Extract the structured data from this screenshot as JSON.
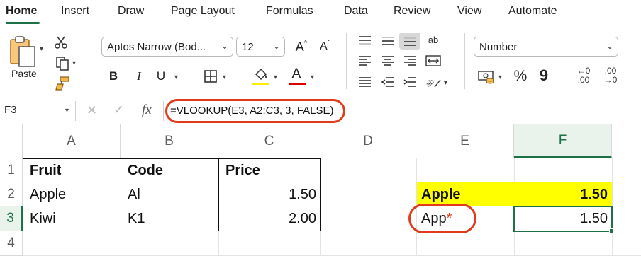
{
  "tabs": [
    "Home",
    "Insert",
    "Draw",
    "Page Layout",
    "Formulas",
    "Data",
    "Review",
    "View",
    "Automate"
  ],
  "ribbon": {
    "paste_label": "Paste",
    "font_name": "Aptos Narrow (Bod...",
    "font_size": "12",
    "bold_label": "B",
    "italic_label": "I",
    "underline_label": "U",
    "font_color_letter": "A",
    "grow_font_letter": "A",
    "shrink_font_letter": "A",
    "number_format": "Number",
    "percent_label": "%",
    "comma_label": "9",
    "increase_decimal_top": "←0",
    "increase_decimal_bottom": ".00",
    "decrease_decimal_top": ".00",
    "decrease_decimal_bottom": "→0",
    "wrap_label": "ab",
    "accent_yellow": "#FFEC00",
    "accent_red": "#E00000"
  },
  "formula_bar": {
    "name_box": "F3",
    "fx_label": "fx",
    "formula": "=VLOOKUP(E3, A2:C3, 3, FALSE)"
  },
  "grid": {
    "columns": [
      "A",
      "B",
      "C",
      "D",
      "E",
      "F"
    ],
    "rows": [
      "1",
      "2",
      "3",
      "4"
    ],
    "cells": {
      "A1": "Fruit",
      "B1": "Code",
      "C1": "Price",
      "A2": "Apple",
      "B2": "Al",
      "C2": "1.50",
      "A3": "Kiwi",
      "B3": "K1",
      "C3": "2.00",
      "E2": "Apple",
      "F2": "1.50",
      "E3": "App",
      "E3_star": "*",
      "F3": "1.50"
    },
    "highlight_color": "#FFFF00",
    "selection_color": "#1E7145",
    "annotation_color": "#E33A1C"
  }
}
